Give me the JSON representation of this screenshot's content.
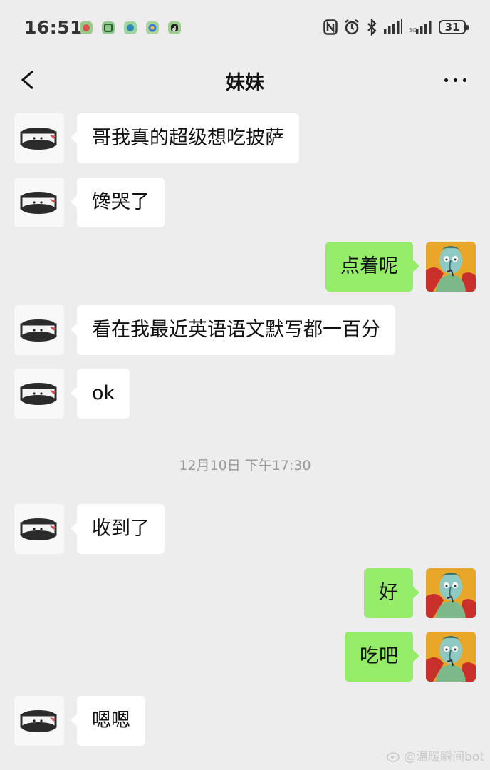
{
  "status_bar": {
    "time": "16:51",
    "battery": "31",
    "app_icons": [
      "app-red-icon",
      "app-green-icon",
      "app-teal-icon",
      "app-blue-icon",
      "app-tiktok-icon"
    ]
  },
  "nav": {
    "title": "妹妹",
    "back_icon": "chevron-left-icon",
    "more_icon": "more-icon"
  },
  "colors": {
    "background": "#ededed",
    "incoming_bubble": "#ffffff",
    "outgoing_bubble": "#95ec69",
    "timestamp_text": "#999999"
  },
  "messages": [
    {
      "direction": "in",
      "text": "哥我真的超级想吃披萨"
    },
    {
      "direction": "in",
      "text": "馋哭了"
    },
    {
      "direction": "out",
      "text": "点着呢"
    },
    {
      "direction": "in",
      "text": "看在我最近英语语文默写都一百分"
    },
    {
      "direction": "in",
      "text": "ok"
    },
    {
      "direction": "in",
      "text": "收到了"
    },
    {
      "direction": "out",
      "text": "好"
    },
    {
      "direction": "out",
      "text": "吃吧"
    },
    {
      "direction": "in",
      "text": "嗯嗯"
    }
  ],
  "timestamp": "12月10日 下午17:30",
  "watermark": "@温暖瞬间bot"
}
